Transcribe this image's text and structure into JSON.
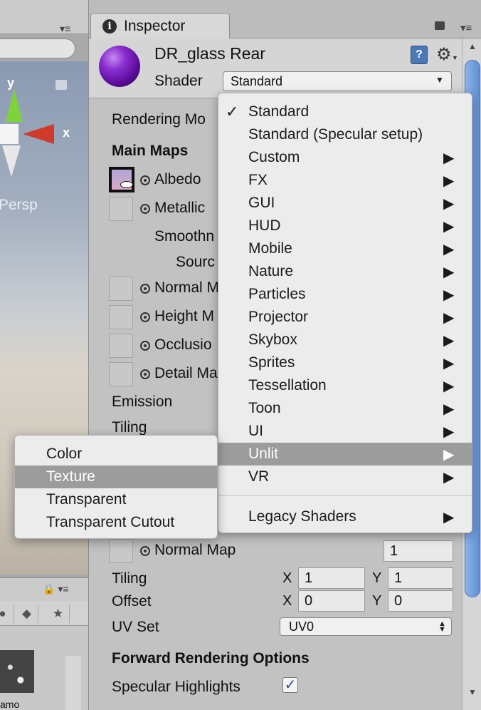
{
  "scene": {
    "axis_y": "y",
    "axis_x": "x",
    "persp_label": "Persp",
    "asset_label": "amo"
  },
  "inspector": {
    "tab_label": "Inspector",
    "info_icon": "i",
    "material": {
      "name": "DR_glass Rear",
      "shader_label": "Shader",
      "shader_value": "Standard",
      "help_icon": "?"
    },
    "properties": {
      "rendering_mode": "Rendering Mo",
      "main_maps": "Main Maps",
      "albedo": "Albedo",
      "metallic": "Metallic",
      "smoothness": "Smoothn",
      "source": "Sourc",
      "normal_map_partial": "Normal M",
      "height_map": "Height M",
      "occlusion": "Occlusio",
      "detail_mask": "Detail Ma",
      "emission": "Emission",
      "tiling_top": "Tiling",
      "normal_map": "Normal Map",
      "normal_map_value": "1",
      "tiling": "Tiling",
      "tiling_x": "1",
      "tiling_y": "1",
      "offset": "Offset",
      "offset_x": "0",
      "offset_y": "0",
      "axis_x": "X",
      "axis_y": "Y",
      "uv_set": "UV Set",
      "uv_set_value": "UV0",
      "forward_rendering": "Forward Rendering Options",
      "specular_highlights": "Specular Highlights",
      "checkmark": "✓"
    }
  },
  "shader_menu": {
    "items": [
      {
        "label": "Standard",
        "checked": true,
        "submenu": false
      },
      {
        "label": "Standard (Specular setup)",
        "checked": false,
        "submenu": false
      },
      {
        "label": "Custom",
        "checked": false,
        "submenu": true
      },
      {
        "label": "FX",
        "checked": false,
        "submenu": true
      },
      {
        "label": "GUI",
        "checked": false,
        "submenu": true
      },
      {
        "label": "HUD",
        "checked": false,
        "submenu": true
      },
      {
        "label": "Mobile",
        "checked": false,
        "submenu": true
      },
      {
        "label": "Nature",
        "checked": false,
        "submenu": true
      },
      {
        "label": "Particles",
        "checked": false,
        "submenu": true
      },
      {
        "label": "Projector",
        "checked": false,
        "submenu": true
      },
      {
        "label": "Skybox",
        "checked": false,
        "submenu": true
      },
      {
        "label": "Sprites",
        "checked": false,
        "submenu": true
      },
      {
        "label": "Tessellation",
        "checked": false,
        "submenu": true
      },
      {
        "label": "Toon",
        "checked": false,
        "submenu": true
      },
      {
        "label": "UI",
        "checked": false,
        "submenu": true
      },
      {
        "label": "Unlit",
        "checked": false,
        "submenu": true,
        "highlighted": true
      },
      {
        "label": "VR",
        "checked": false,
        "submenu": true
      }
    ],
    "legacy": {
      "label": "Legacy Shaders",
      "submenu": true
    },
    "check_glyph": "✓",
    "arrow_glyph": "▶"
  },
  "unlit_submenu": {
    "items": [
      {
        "label": "Color"
      },
      {
        "label": "Texture",
        "highlighted": true
      },
      {
        "label": "Transparent"
      },
      {
        "label": "Transparent Cutout"
      }
    ]
  }
}
